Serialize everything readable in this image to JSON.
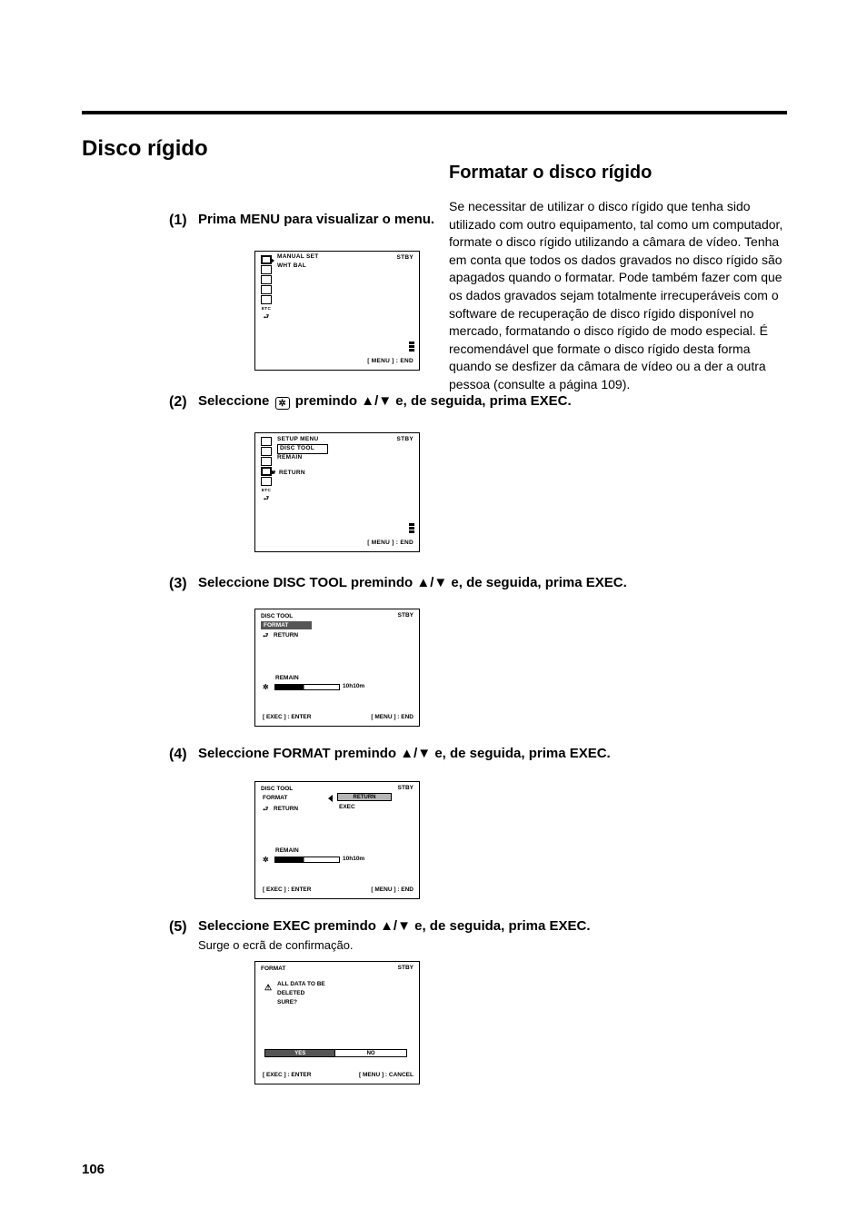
{
  "page_number": "106",
  "chapter_title": "Disco rígido",
  "right": {
    "heading": "Formatar o disco rígido",
    "p1": "Se necessitar de utilizar o disco rígido que tenha sido utilizado com outro equipamento, tal como um computador, formate o disco rígido utilizando a câmara de vídeo. Tenha em conta que todos os dados gravados no disco rígido são apagados quando o formatar. Pode também fazer com que os dados gravados sejam totalmente irrecuperáveis com o software de recuperação de disco rígido disponível no mercado, formatando o disco rígido de modo especial. É recomendável que formate o disco rígido desta forma quando se desfizer da câmara de vídeo ou a der a outra pessoa (consulte a página 109)."
  },
  "steps": [
    {
      "num": "(1)",
      "text_pre": "Prima MENU para visualizar o menu."
    },
    {
      "num": "(2)",
      "text_pre": "Seleccione ",
      "icon": "gear",
      "text_mid": " premindo ",
      "glyphs": true,
      "text_post": " e, de seguida, prima EXEC."
    },
    {
      "num": "(3)",
      "text_pre": "Seleccione DISC TOOL premindo ",
      "glyphs": true,
      "text_post": " e, de seguida, prima EXEC."
    },
    {
      "num": "(4)",
      "text_pre": "Seleccione FORMAT premindo ",
      "glyphs": true,
      "text_post": " e, de seguida, prima EXEC."
    },
    {
      "num": "(5)",
      "text_pre": "Seleccione EXEC premindo ",
      "glyphs": true,
      "text_post": " e, de seguida, prima EXEC.",
      "extra": "Surge o ecrã de confirmação."
    }
  ],
  "lcd1": {
    "header": "STBY",
    "hint_end": "[ MENU ] : END"
  },
  "lcd2_a": {
    "header": "STBY",
    "title": "SETUP MENU",
    "items": [
      "DISC TOOL",
      "REMAIN"
    ],
    "return_label": "RETURN",
    "hint_end": "[ MENU ] : END"
  },
  "lcd2_b": {
    "header": "STBY",
    "title": "DISC TOOL",
    "item": "FORMAT",
    "return": "RETURN",
    "remain_label": "REMAIN",
    "hint_exec": "[ EXEC ] : ENTER",
    "hint_end": "[ MENU ] : END"
  },
  "lcd2_c": {
    "header": "STBY",
    "title": "DISC TOOL",
    "item": "FORMAT",
    "return_option": "RETURN",
    "exec_option": "EXEC",
    "return": "RETURN",
    "remain_label": "REMAIN",
    "hint_exec": "[ EXEC ] : ENTER",
    "hint_end": "[ MENU ] : END"
  },
  "lcd2_d": {
    "header": "STBY",
    "title": "FORMAT",
    "warn_lines": [
      "ALL DATA TO BE",
      "DELETED",
      "SURE?"
    ],
    "btn_yes": "YES",
    "btn_no": "NO",
    "hint_exec": "[ EXEC ] : ENTER",
    "hint_cancel": "[ MENU ] : CANCEL"
  }
}
